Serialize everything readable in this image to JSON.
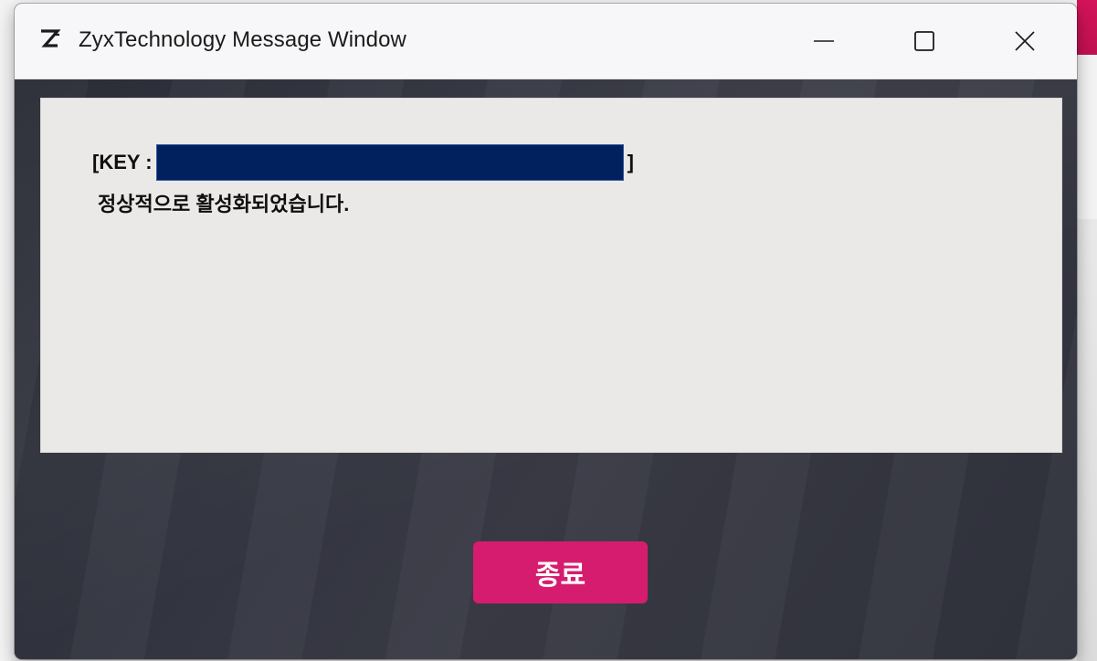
{
  "window": {
    "title": "ZyxTechnology Message Window",
    "logo_icon": "zyx-logo-icon",
    "controls": {
      "minimize_icon": "minimize-icon",
      "maximize_icon": "maximize-icon",
      "close_icon": "close-icon"
    }
  },
  "message": {
    "key_prefix": "[KEY :",
    "key_suffix": "]",
    "key_value_redacted": true,
    "text": "정상적으로 활성화되었습니다."
  },
  "actions": {
    "exit_label": "종료"
  },
  "colors": {
    "accent": "#d61c6e",
    "panel_bg": "#ebe9e8",
    "redaction": "#00205e",
    "wallpaper": "#30323c"
  }
}
